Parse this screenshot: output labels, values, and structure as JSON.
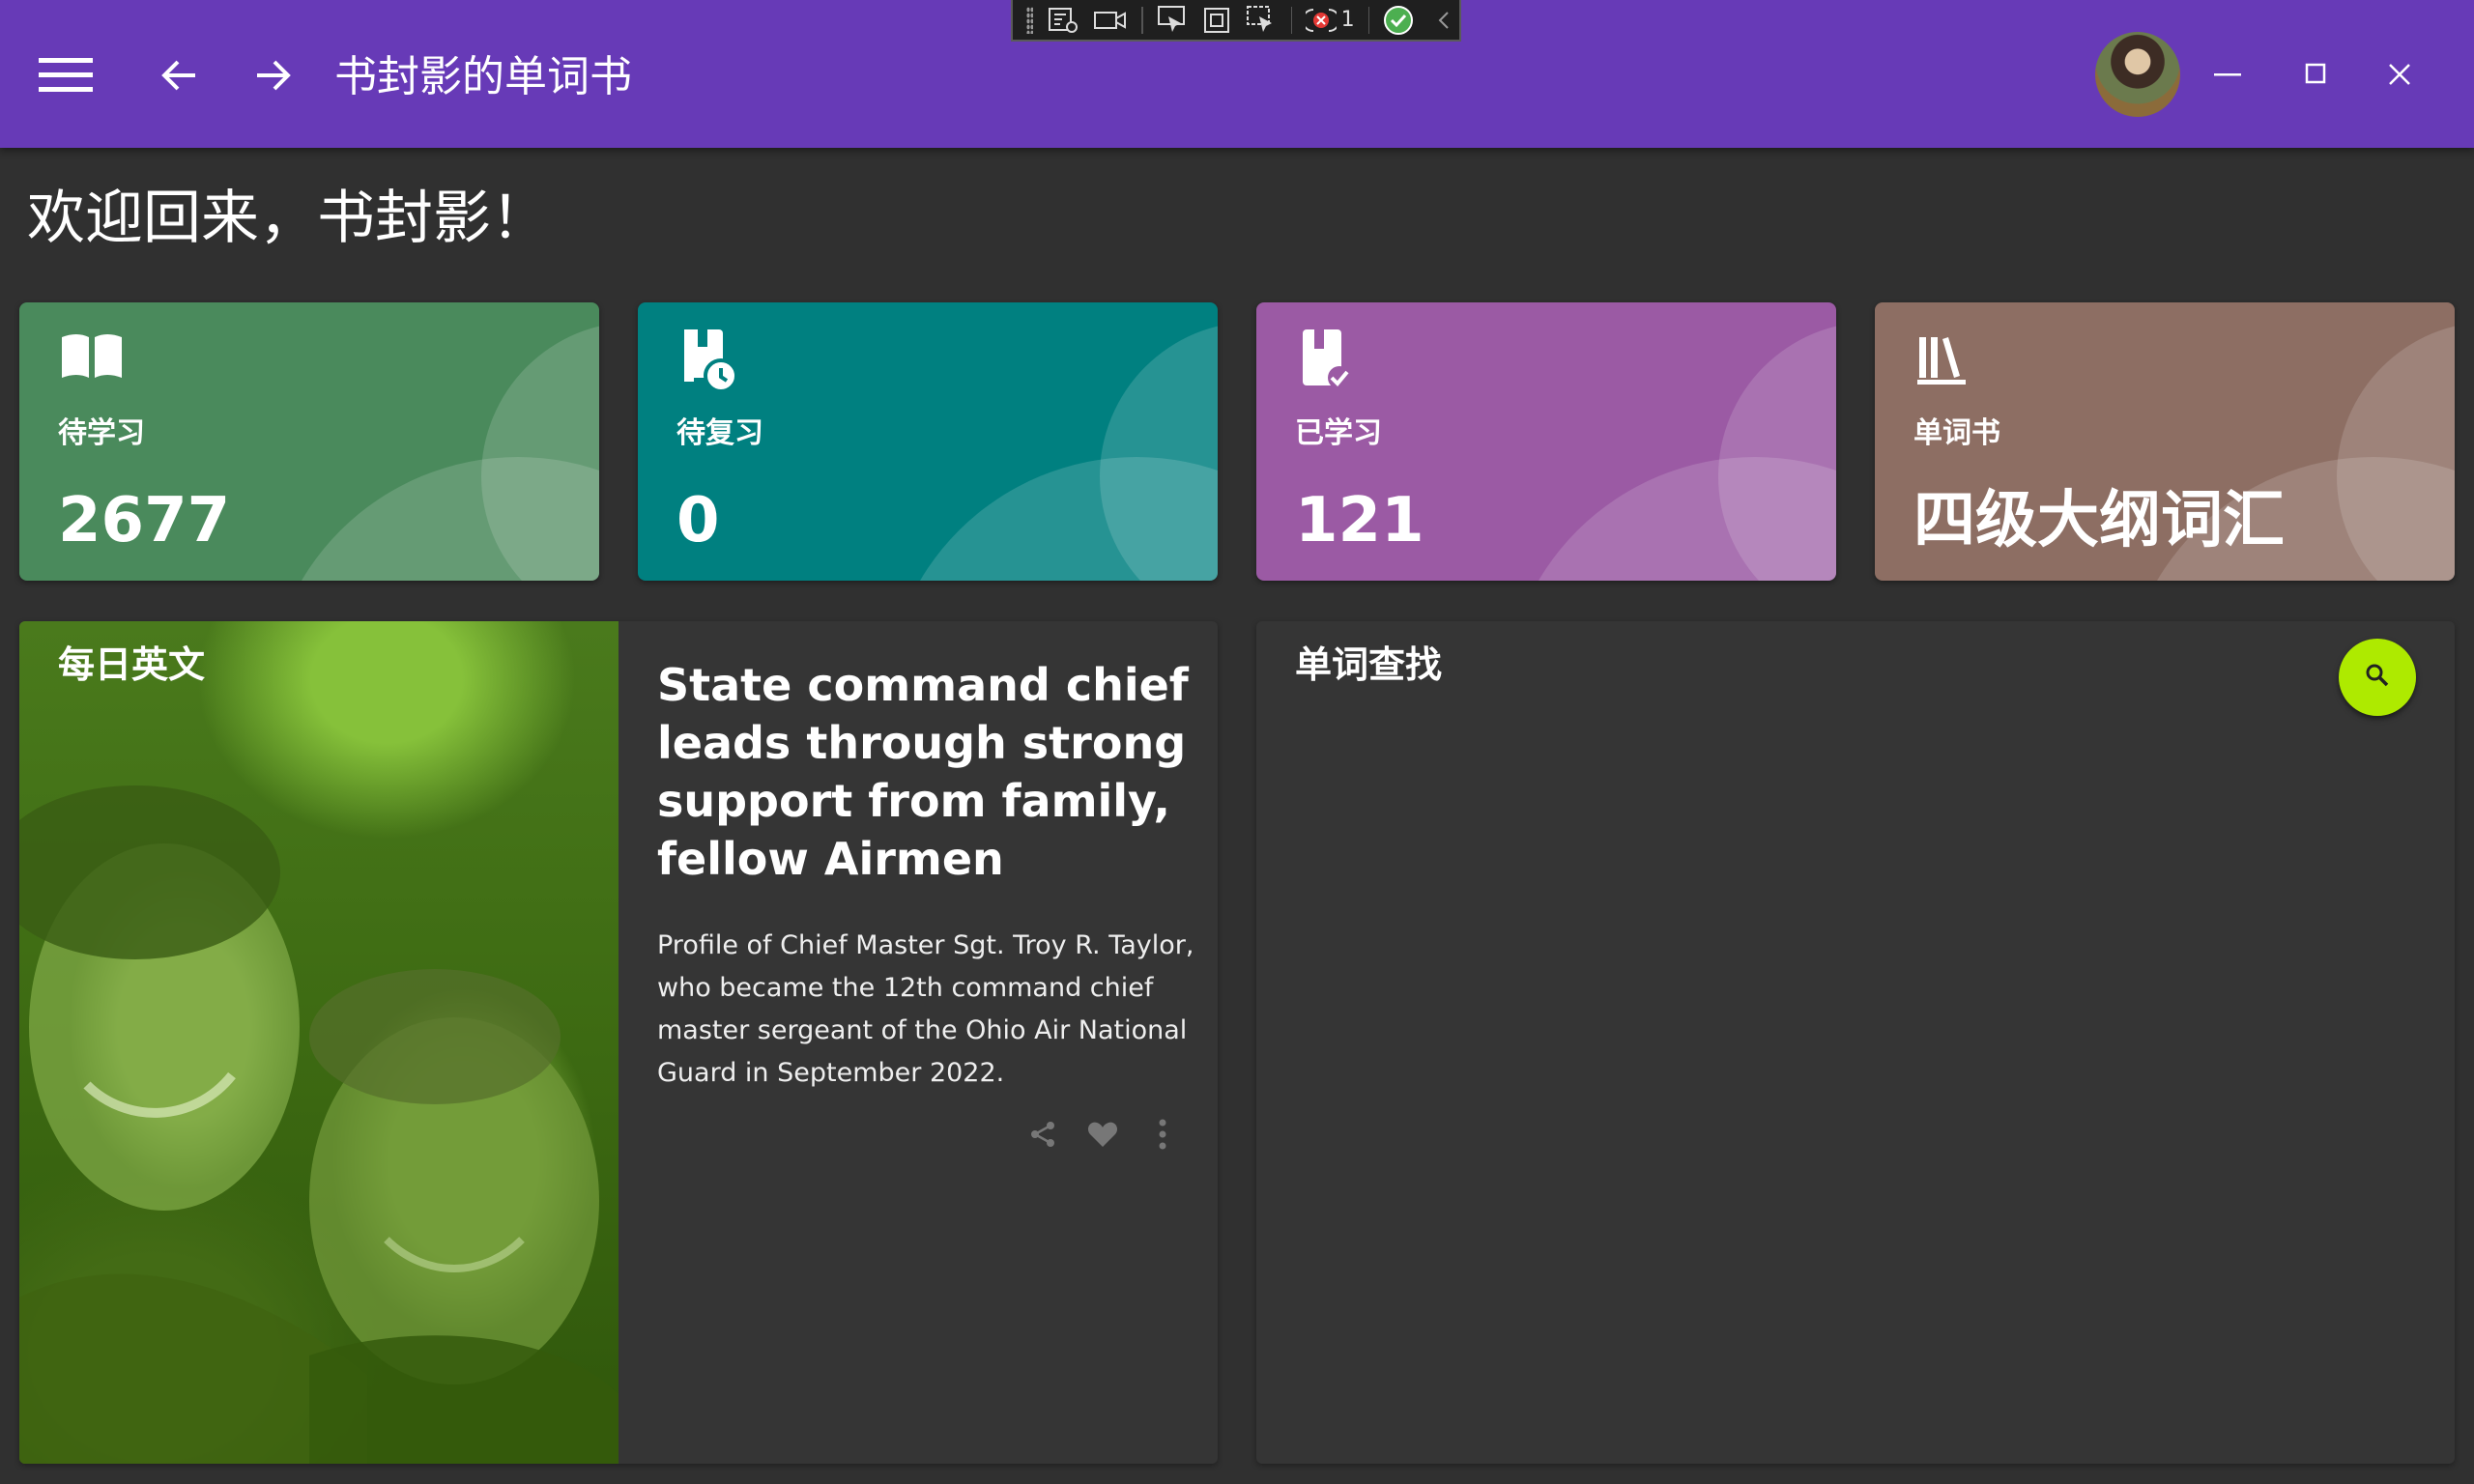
{
  "app": {
    "title": "书封影的单词书",
    "menu_icon": "hamburger-menu-icon",
    "back_icon": "arrow-back-icon",
    "forward_icon": "arrow-forward-icon",
    "window_controls": [
      "minimize-icon",
      "maximize-icon",
      "close-icon"
    ]
  },
  "devtools": {
    "icons": [
      "live-visual-tree-icon",
      "video-record-icon",
      "select-element-icon",
      "display-layout-adorners-icon",
      "track-focus-icon",
      "binding-failures-icon",
      "hot-reload-ok-icon",
      "collapse-chevron-icon"
    ],
    "binding_failures_count": "1"
  },
  "welcome": "欢迎回来，书封影！",
  "cards": [
    {
      "label": "待学习",
      "value": "2677",
      "icon": "open-book-icon",
      "color": "#4a8a5c"
    },
    {
      "label": "待复习",
      "value": "0",
      "icon": "bookmark-clock-icon",
      "color": "#008080"
    },
    {
      "label": "已学习",
      "value": "121",
      "icon": "bookmark-check-icon",
      "color": "#9b5aa4"
    },
    {
      "label": "单词书",
      "value": "四级大纲词汇",
      "icon": "bookshelf-icon",
      "color": "#8d6e63"
    }
  ],
  "daily": {
    "title": "每日英文",
    "headline": "State command chief leads through strong support from family, fellow Airmen",
    "summary": "Profile of Chief Master Sgt. Troy R. Taylor, who became the 12th command chief master sergeant of the Ohio Air National Guard in September 2022.",
    "actions": [
      "share-icon",
      "heart-icon",
      "more-vert-icon"
    ]
  },
  "search": {
    "title": "单词查找",
    "button_icon": "search-icon",
    "accent": "#aeea00"
  },
  "colors": {
    "appbar": "#673ab7",
    "background": "#303030",
    "panel": "#353535"
  }
}
